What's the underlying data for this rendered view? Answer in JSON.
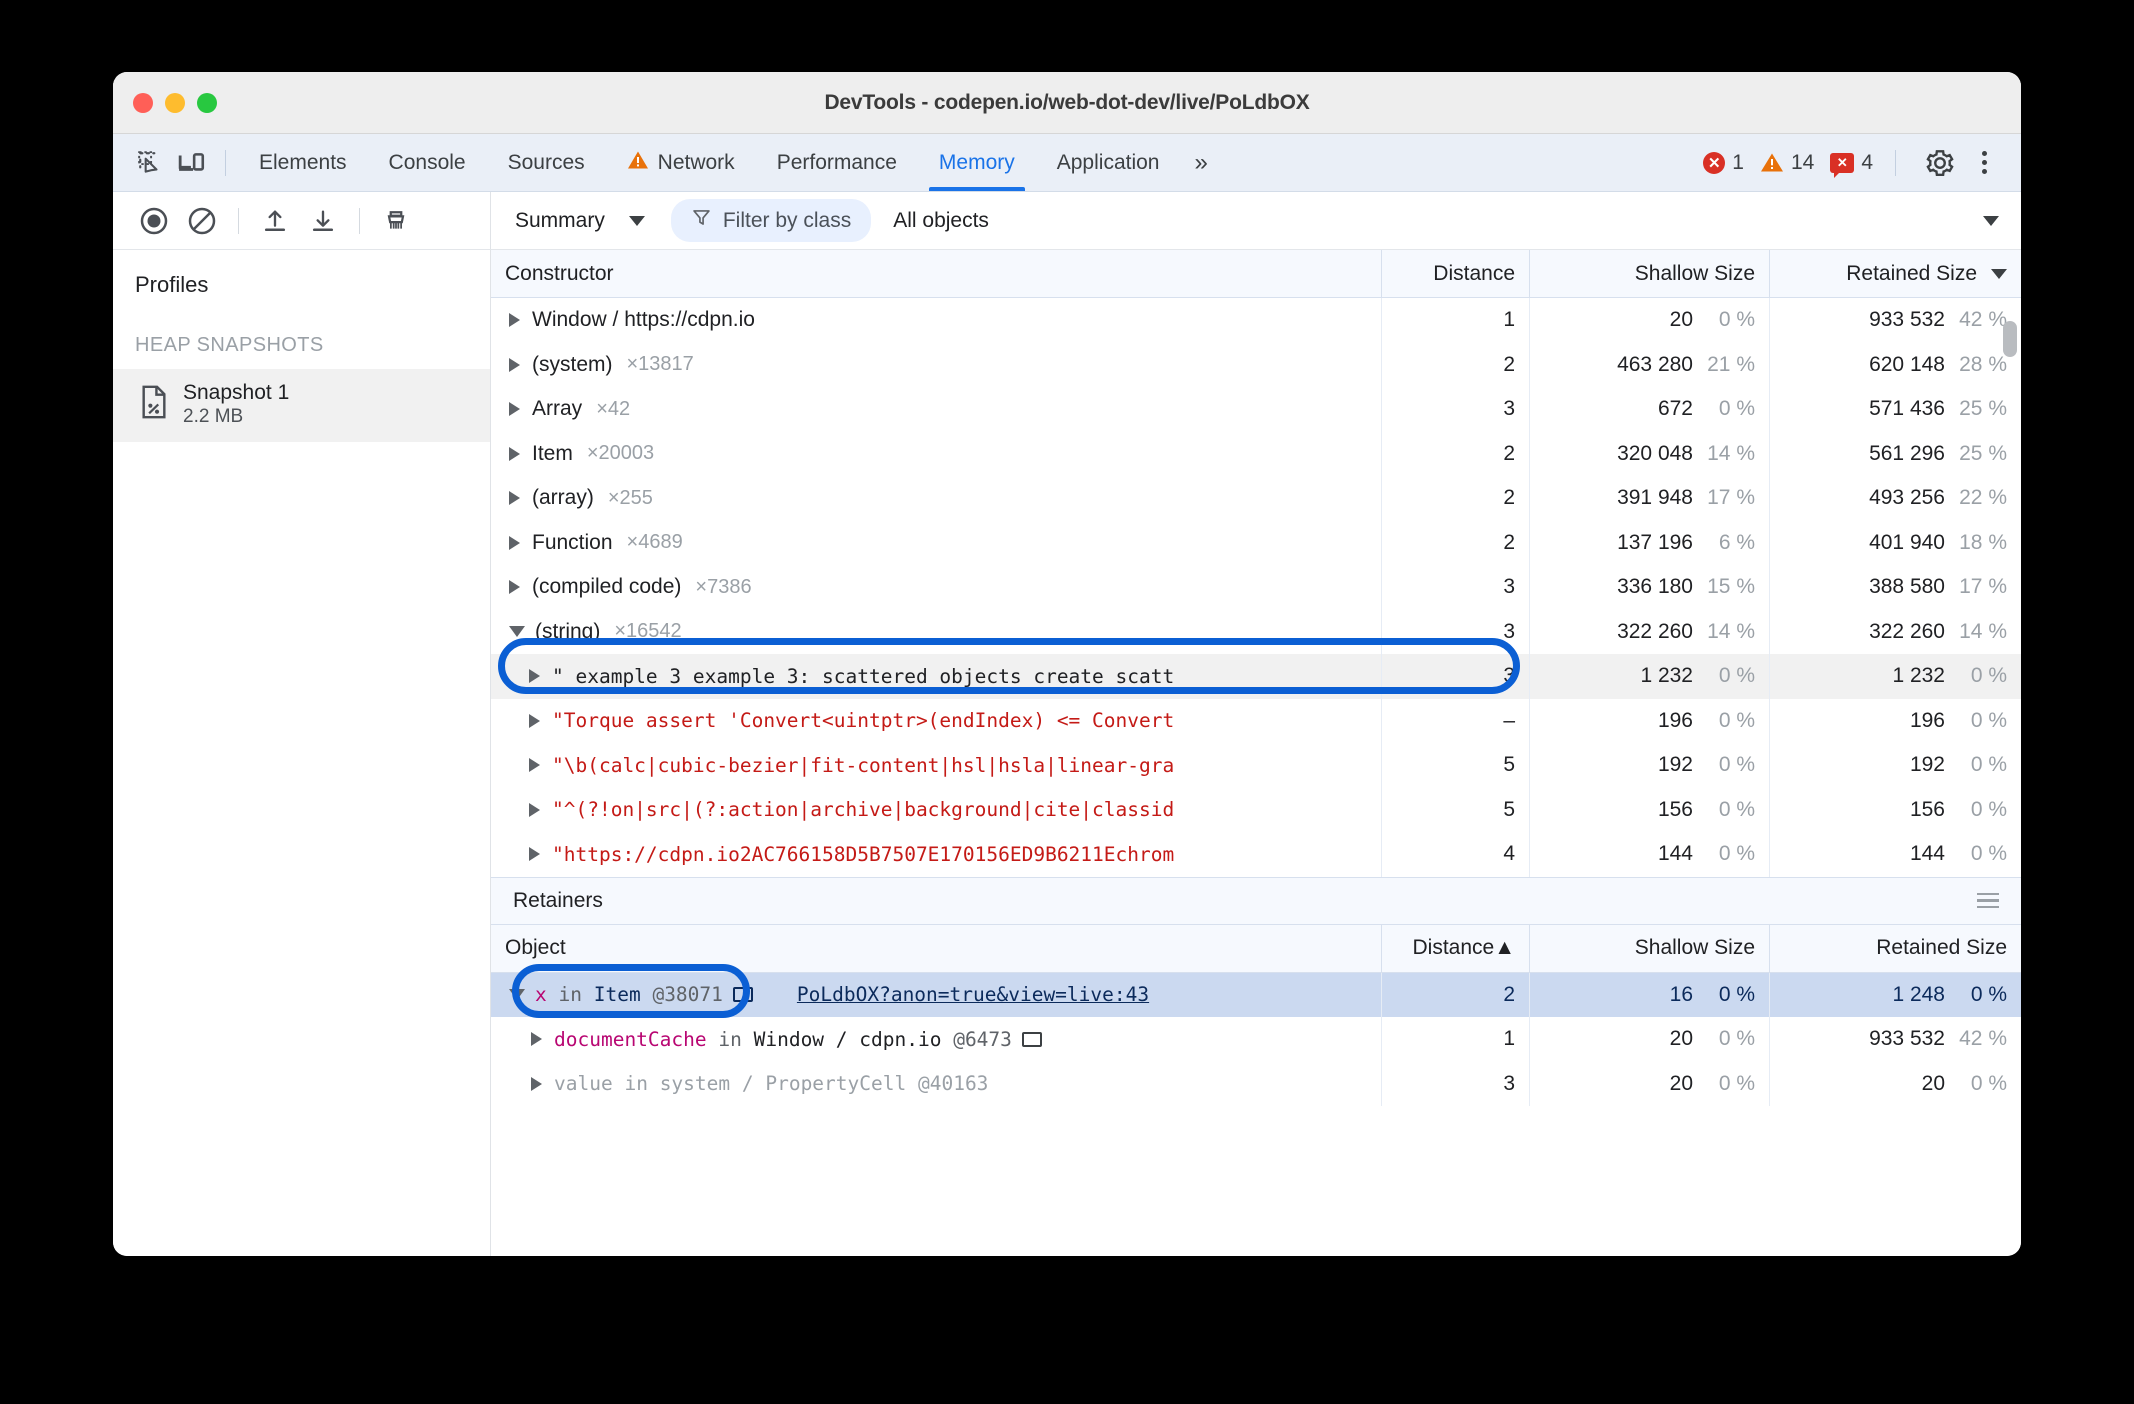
{
  "window": {
    "title": "DevTools - codepen.io/web-dot-dev/live/PoLdbOX"
  },
  "tabs": {
    "items": [
      {
        "label": "Elements",
        "active": false,
        "warn": false
      },
      {
        "label": "Console",
        "active": false,
        "warn": false
      },
      {
        "label": "Sources",
        "active": false,
        "warn": false
      },
      {
        "label": "Network",
        "active": false,
        "warn": true
      },
      {
        "label": "Performance",
        "active": false,
        "warn": false
      },
      {
        "label": "Memory",
        "active": true,
        "warn": false
      },
      {
        "label": "Application",
        "active": false,
        "warn": false
      }
    ],
    "more": "»"
  },
  "status": {
    "errors": "1",
    "warnings": "14",
    "violations": "4",
    "error_glyph": "✕",
    "violation_glyph": "✕"
  },
  "toolbar": {
    "view_select": "Summary",
    "filter_label": "Filter by class",
    "objects_select": "All objects"
  },
  "sidebar": {
    "title": "Profiles",
    "section": "HEAP SNAPSHOTS",
    "snapshot": {
      "name": "Snapshot 1",
      "size": "2.2 MB"
    }
  },
  "constructors": {
    "headers": {
      "constructor": "Constructor",
      "distance": "Distance",
      "shallow": "Shallow Size",
      "retained": "Retained Size"
    },
    "rows": [
      {
        "name": "Window / https://cdpn.io",
        "count": "",
        "distance": "1",
        "shallow": "20",
        "shallow_pct": "0 %",
        "retained": "933 532",
        "retained_pct": "42 %",
        "expanded": false,
        "style": "plain"
      },
      {
        "name": "(system)",
        "count": "×13817",
        "distance": "2",
        "shallow": "463 280",
        "shallow_pct": "21 %",
        "retained": "620 148",
        "retained_pct": "28 %",
        "expanded": false,
        "style": "plain"
      },
      {
        "name": "Array",
        "count": "×42",
        "distance": "3",
        "shallow": "672",
        "shallow_pct": "0 %",
        "retained": "571 436",
        "retained_pct": "25 %",
        "expanded": false,
        "style": "plain"
      },
      {
        "name": "Item",
        "count": "×20003",
        "distance": "2",
        "shallow": "320 048",
        "shallow_pct": "14 %",
        "retained": "561 296",
        "retained_pct": "25 %",
        "expanded": false,
        "style": "plain"
      },
      {
        "name": "(array)",
        "count": "×255",
        "distance": "2",
        "shallow": "391 948",
        "shallow_pct": "17 %",
        "retained": "493 256",
        "retained_pct": "22 %",
        "expanded": false,
        "style": "plain"
      },
      {
        "name": "Function",
        "count": "×4689",
        "distance": "2",
        "shallow": "137 196",
        "shallow_pct": "6 %",
        "retained": "401 940",
        "retained_pct": "18 %",
        "expanded": false,
        "style": "plain"
      },
      {
        "name": "(compiled code)",
        "count": "×7386",
        "distance": "3",
        "shallow": "336 180",
        "shallow_pct": "15 %",
        "retained": "388 580",
        "retained_pct": "17 %",
        "expanded": false,
        "style": "plain"
      },
      {
        "name": "(string)",
        "count": "×16542",
        "distance": "3",
        "shallow": "322 260",
        "shallow_pct": "14 %",
        "retained": "322 260",
        "retained_pct": "14 %",
        "expanded": true,
        "style": "plain"
      }
    ],
    "string_children": [
      {
        "text": "\" example 3 example 3: scattered objects create scatt",
        "distance": "3",
        "shallow": "1 232",
        "shallow_pct": "0 %",
        "retained": "1 232",
        "retained_pct": "0 %",
        "color": "black",
        "highlighted": true
      },
      {
        "text": "\"Torque assert 'Convert<uintptr>(endIndex) <= Convert",
        "distance": "–",
        "shallow": "196",
        "shallow_pct": "0 %",
        "retained": "196",
        "retained_pct": "0 %",
        "color": "red",
        "highlighted": false
      },
      {
        "text": "\"\\b(calc|cubic-bezier|fit-content|hsl|hsla|linear-gra",
        "distance": "5",
        "shallow": "192",
        "shallow_pct": "0 %",
        "retained": "192",
        "retained_pct": "0 %",
        "color": "red",
        "highlighted": false
      },
      {
        "text": "\"^(?!on|src|(?:action|archive|background|cite|classid",
        "distance": "5",
        "shallow": "156",
        "shallow_pct": "0 %",
        "retained": "156",
        "retained_pct": "0 %",
        "color": "red",
        "highlighted": false
      },
      {
        "text": "\"https://cdpn.io2AC766158D5B7507E170156ED9B6211Echrom",
        "distance": "4",
        "shallow": "144",
        "shallow_pct": "0 %",
        "retained": "144",
        "retained_pct": "0 %",
        "color": "red",
        "highlighted": false
      }
    ]
  },
  "retainers": {
    "panel_title": "Retainers",
    "headers": {
      "object": "Object",
      "distance": "Distance▲",
      "shallow": "Shallow Size",
      "retained": "Retained Size"
    },
    "rows": [
      {
        "prefix": "x",
        "kw": "in",
        "owner": "Item",
        "id": "@38071",
        "has_box": true,
        "link": "PoLdbOX?anon=true&view=live:43",
        "distance": "2",
        "shallow": "16",
        "shallow_pct": "0 %",
        "retained": "1 248",
        "retained_pct": "0 %",
        "expanded": true,
        "selected": true,
        "indent": 0,
        "dim": false
      },
      {
        "prefix": "documentCache",
        "kw": "in",
        "owner": "Window / cdpn.io",
        "id": "@6473",
        "has_box": true,
        "link": "",
        "distance": "1",
        "shallow": "20",
        "shallow_pct": "0 %",
        "retained": "933 532",
        "retained_pct": "42 %",
        "expanded": false,
        "selected": false,
        "indent": 1,
        "dim": false
      },
      {
        "prefix": "value",
        "kw": "in",
        "owner": "system / PropertyCell",
        "id": "@40163",
        "has_box": false,
        "link": "",
        "distance": "3",
        "shallow": "20",
        "shallow_pct": "0 %",
        "retained": "20",
        "retained_pct": "0 %",
        "expanded": false,
        "selected": false,
        "indent": 1,
        "dim": true
      }
    ]
  },
  "colors": {
    "accent": "#1a73e8",
    "highlight_ring": "#0b5fd4",
    "error": "#d93025",
    "warning": "#e8710a",
    "string_red": "#c41a16",
    "selected_row": "#cbd9f0"
  }
}
